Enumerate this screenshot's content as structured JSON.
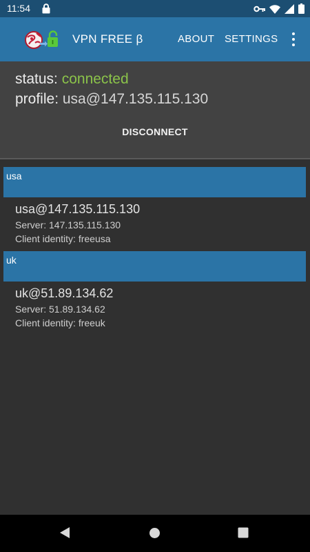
{
  "status_bar": {
    "time": "11:54",
    "icons": [
      "lock-icon",
      "vpn-key-icon",
      "wifi-icon",
      "cell-signal-icon",
      "battery-icon"
    ]
  },
  "app_bar": {
    "title": "VPN FREE β",
    "logo": "vpn-logo-icon",
    "actions": {
      "about": "ABOUT",
      "settings": "SETTINGS"
    },
    "overflow": "more-vert-icon",
    "color": "#2b74a6"
  },
  "status_panel": {
    "status_label": "status:",
    "status_value": "connected",
    "status_color": "#8bc34a",
    "profile_label": "profile:",
    "profile_value": "usa@147.135.115.130",
    "disconnect_label": "DISCONNECT"
  },
  "groups": [
    {
      "header": "usa",
      "profile": {
        "name": "usa@147.135.115.130",
        "server": "Server: 147.135.115.130",
        "identity": "Client identity: freeusa"
      }
    },
    {
      "header": "uk",
      "profile": {
        "name": "uk@51.89.134.62",
        "server": "Server: 51.89.134.62",
        "identity": "Client identity: freeuk"
      }
    }
  ],
  "nav_bar": {
    "buttons": [
      "back-icon",
      "home-icon",
      "recents-icon"
    ]
  }
}
